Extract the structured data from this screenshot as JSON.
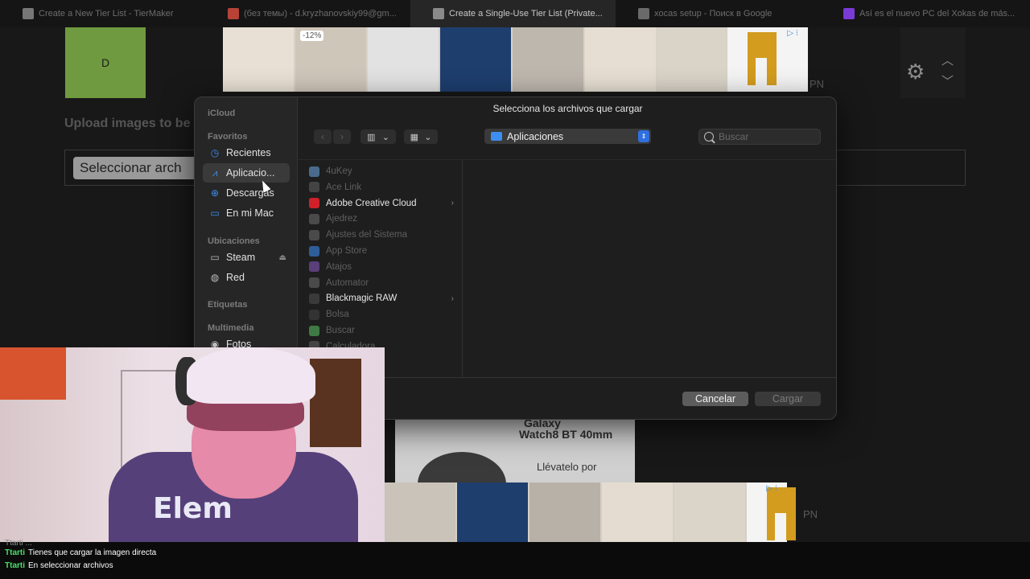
{
  "tabs": [
    {
      "title": "Create a New Tier List - TierMaker",
      "active": false,
      "color": "#777777"
    },
    {
      "title": "(без темы) - d.kryzhanovskiy99@gm...",
      "active": false,
      "color": "#b84236"
    },
    {
      "title": "Create a Single-Use Tier List (Private...",
      "active": true,
      "color": "#8a8a8a"
    },
    {
      "title": "xocas setup - Поиск в Google",
      "active": false,
      "color": "#6a6a6a"
    },
    {
      "title": "Así es el nuevo PC del Xokas de más...",
      "active": false,
      "color": "#7a3ad6"
    }
  ],
  "page": {
    "tier_label": "D",
    "discount_badge": "-12%",
    "ad_label_top": "PN",
    "ad_label_bottom": "PN",
    "upload_title": "Upload images to be",
    "file_button": "Seleccionar arch",
    "ad_watch": {
      "line1": "Galaxy",
      "line2": "Watch8 BT 40mm",
      "line3": "Llévatelo por"
    },
    "hoodie_text": "Elem"
  },
  "dialog": {
    "title": "Selecciona los archivos que cargar",
    "location": "Aplicaciones",
    "search_placeholder": "Buscar",
    "cancel": "Cancelar",
    "load": "Cargar",
    "sidebar": {
      "icloud": "iCloud",
      "favorites_heading": "Favoritos",
      "favorites": [
        {
          "label": "Recientes",
          "icon": "clock-icon",
          "active": false
        },
        {
          "label": "Aplicacio...",
          "icon": "app-store-icon",
          "active": true
        },
        {
          "label": "Descargas",
          "icon": "download-icon",
          "active": false
        },
        {
          "label": "En mi Mac",
          "icon": "folder-icon",
          "active": false
        }
      ],
      "locations_heading": "Ubicaciones",
      "locations": [
        {
          "label": "Steam",
          "icon": "drive-icon"
        },
        {
          "label": "Red",
          "icon": "network-icon"
        }
      ],
      "tags_heading": "Etiquetas",
      "media_heading": "Multimedia",
      "media": [
        {
          "label": "Fotos",
          "icon": "camera-icon"
        }
      ]
    },
    "files": [
      {
        "name": "4uKey",
        "enabled": false,
        "icon_color": "#4a6a8c",
        "folder": false
      },
      {
        "name": "Ace Link",
        "enabled": false,
        "icon_color": "#444444",
        "folder": false
      },
      {
        "name": "Adobe Creative Cloud",
        "enabled": true,
        "icon_color": "#d0202a",
        "folder": true
      },
      {
        "name": "Ajedrez",
        "enabled": false,
        "icon_color": "#4a4a4a",
        "folder": false
      },
      {
        "name": "Ajustes del Sistema",
        "enabled": false,
        "icon_color": "#4a4a4a",
        "folder": false
      },
      {
        "name": "App Store",
        "enabled": false,
        "icon_color": "#2f5d9a",
        "folder": false
      },
      {
        "name": "Atajos",
        "enabled": false,
        "icon_color": "#5a3f7a",
        "folder": false
      },
      {
        "name": "Automator",
        "enabled": false,
        "icon_color": "#4a4a4a",
        "folder": false
      },
      {
        "name": "Blackmagic RAW",
        "enabled": true,
        "icon_color": "#3a3a3a",
        "folder": true
      },
      {
        "name": "Bolsa",
        "enabled": false,
        "icon_color": "#333333",
        "folder": false
      },
      {
        "name": "Buscar",
        "enabled": false,
        "icon_color": "#3f7a44",
        "folder": false
      },
      {
        "name": "Calculadora",
        "enabled": false,
        "icon_color": "#444444",
        "folder": false
      }
    ]
  },
  "chat": {
    "partial": "Ttarti  ...",
    "messages": [
      {
        "user": "Ttarti",
        "text": "Tienes que cargar la imagen directa"
      },
      {
        "user": "Ttarti",
        "text": "En seleccionar archivos"
      }
    ]
  }
}
